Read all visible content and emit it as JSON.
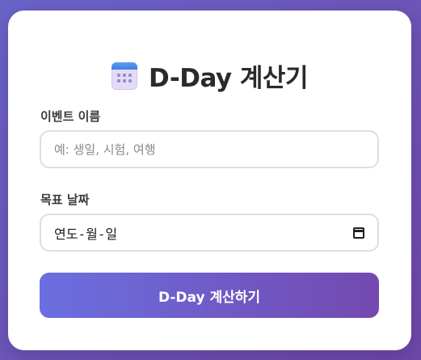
{
  "header": {
    "icon": "calendar-icon",
    "title": "D-Day 계산기"
  },
  "form": {
    "event_name": {
      "label": "이벤트 이름",
      "placeholder": "예: 생일, 시험, 여행",
      "value": ""
    },
    "target_date": {
      "label": "목표 날짜",
      "placeholder": "연도-월-일",
      "icon": "calendar-picker-icon"
    },
    "submit_label": "D-Day 계산하기"
  },
  "colors": {
    "background_start": "#6a64c8",
    "background_end": "#7048a8",
    "button_start": "#6b6fe0",
    "button_end": "#7449b0"
  }
}
